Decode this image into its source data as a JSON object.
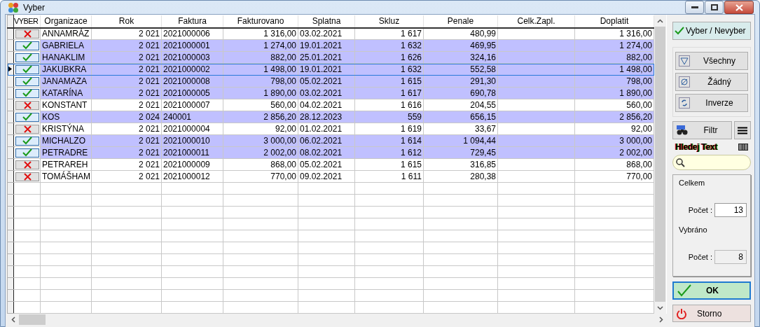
{
  "window": {
    "title": "Vyber"
  },
  "table": {
    "columns": [
      {
        "label": "VYBER",
        "kind": "check"
      },
      {
        "label": "Organizace",
        "kind": "text"
      },
      {
        "label": "Rok",
        "kind": "number"
      },
      {
        "label": "Faktura",
        "kind": "text"
      },
      {
        "label": "Fakturovano",
        "kind": "number"
      },
      {
        "label": "Splatna",
        "kind": "text"
      },
      {
        "label": "Skluz",
        "kind": "number"
      },
      {
        "label": "Penale",
        "kind": "number"
      },
      {
        "label": "Celk.Zapl.",
        "kind": "blank"
      },
      {
        "label": "Doplatit",
        "kind": "number"
      }
    ],
    "rows": [
      {
        "selected": false,
        "current": false,
        "values": [
          "ANNAMRÁZ",
          "2 021",
          "2021000006",
          "1 316,00",
          "03.02.2021",
          "1 617",
          "480,99",
          "1 316,00"
        ]
      },
      {
        "selected": true,
        "current": false,
        "values": [
          "GABRIELA",
          "2 021",
          "2021000001",
          "1 274,00",
          "19.01.2021",
          "1 632",
          "469,95",
          "1 274,00"
        ]
      },
      {
        "selected": true,
        "current": false,
        "values": [
          "HANAKLIM",
          "2 021",
          "2021000003",
          "882,00",
          "25.01.2021",
          "1 626",
          "324,16",
          "882,00"
        ]
      },
      {
        "selected": true,
        "current": true,
        "values": [
          "JAKUBKRA",
          "2 021",
          "2021000002",
          "1 498,00",
          "19.01.2021",
          "1 632",
          "552,58",
          "1 498,00"
        ]
      },
      {
        "selected": true,
        "current": false,
        "values": [
          "JANAMAZA",
          "2 021",
          "2021000008",
          "798,00",
          "05.02.2021",
          "1 615",
          "291,30",
          "798,00"
        ]
      },
      {
        "selected": true,
        "current": false,
        "values": [
          "KATARÍNA",
          "2 021",
          "2021000005",
          "1 890,00",
          "03.02.2021",
          "1 617",
          "690,78",
          "1 890,00"
        ]
      },
      {
        "selected": false,
        "current": false,
        "values": [
          "KONSTANT",
          "2 021",
          "2021000007",
          "560,00",
          "04.02.2021",
          "1 616",
          "204,55",
          "560,00"
        ]
      },
      {
        "selected": true,
        "current": false,
        "values": [
          "KOS",
          "2 024",
          "240001",
          "2 856,20",
          "28.12.2023",
          "559",
          "656,15",
          "2 856,20"
        ]
      },
      {
        "selected": false,
        "current": false,
        "values": [
          "KRISTÝNA",
          "2 021",
          "2021000004",
          "92,00",
          "01.02.2021",
          "1 619",
          "33,67",
          "92,00"
        ]
      },
      {
        "selected": true,
        "current": false,
        "values": [
          "MICHALZO",
          "2 021",
          "2021000010",
          "3 000,00",
          "06.02.2021",
          "1 614",
          "1 094,44",
          "3 000,00"
        ]
      },
      {
        "selected": true,
        "current": false,
        "values": [
          "PETRADRE",
          "2 021",
          "2021000011",
          "2 002,00",
          "08.02.2021",
          "1 612",
          "729,45",
          "2 002,00"
        ]
      },
      {
        "selected": false,
        "current": false,
        "values": [
          "PETRAREH",
          "2 021",
          "2021000009",
          "868,00",
          "05.02.2021",
          "1 615",
          "316,85",
          "868,00"
        ]
      },
      {
        "selected": false,
        "current": false,
        "values": [
          "TOMÁŠHAM",
          "2 021",
          "2021000012",
          "770,00",
          "09.02.2021",
          "1 611",
          "280,38",
          "770,00"
        ]
      }
    ]
  },
  "panel": {
    "toggle_button": "Vyber / Nevyber",
    "select_buttons": [
      {
        "label": "Všechny",
        "kind": "all"
      },
      {
        "label": "Žádný",
        "kind": "none"
      },
      {
        "label": "Inverze",
        "kind": "invert"
      }
    ],
    "filter_button": "Filtr",
    "search_label": "Hledej Text",
    "totals": [
      {
        "title": "Celkem",
        "count_label": "Počet :",
        "count": "13",
        "readonly": false
      },
      {
        "title": "Vybráno",
        "count_label": "Počet :",
        "count": "8",
        "readonly": true
      }
    ],
    "ok_button": "OK",
    "cancel_button": "Storno"
  }
}
